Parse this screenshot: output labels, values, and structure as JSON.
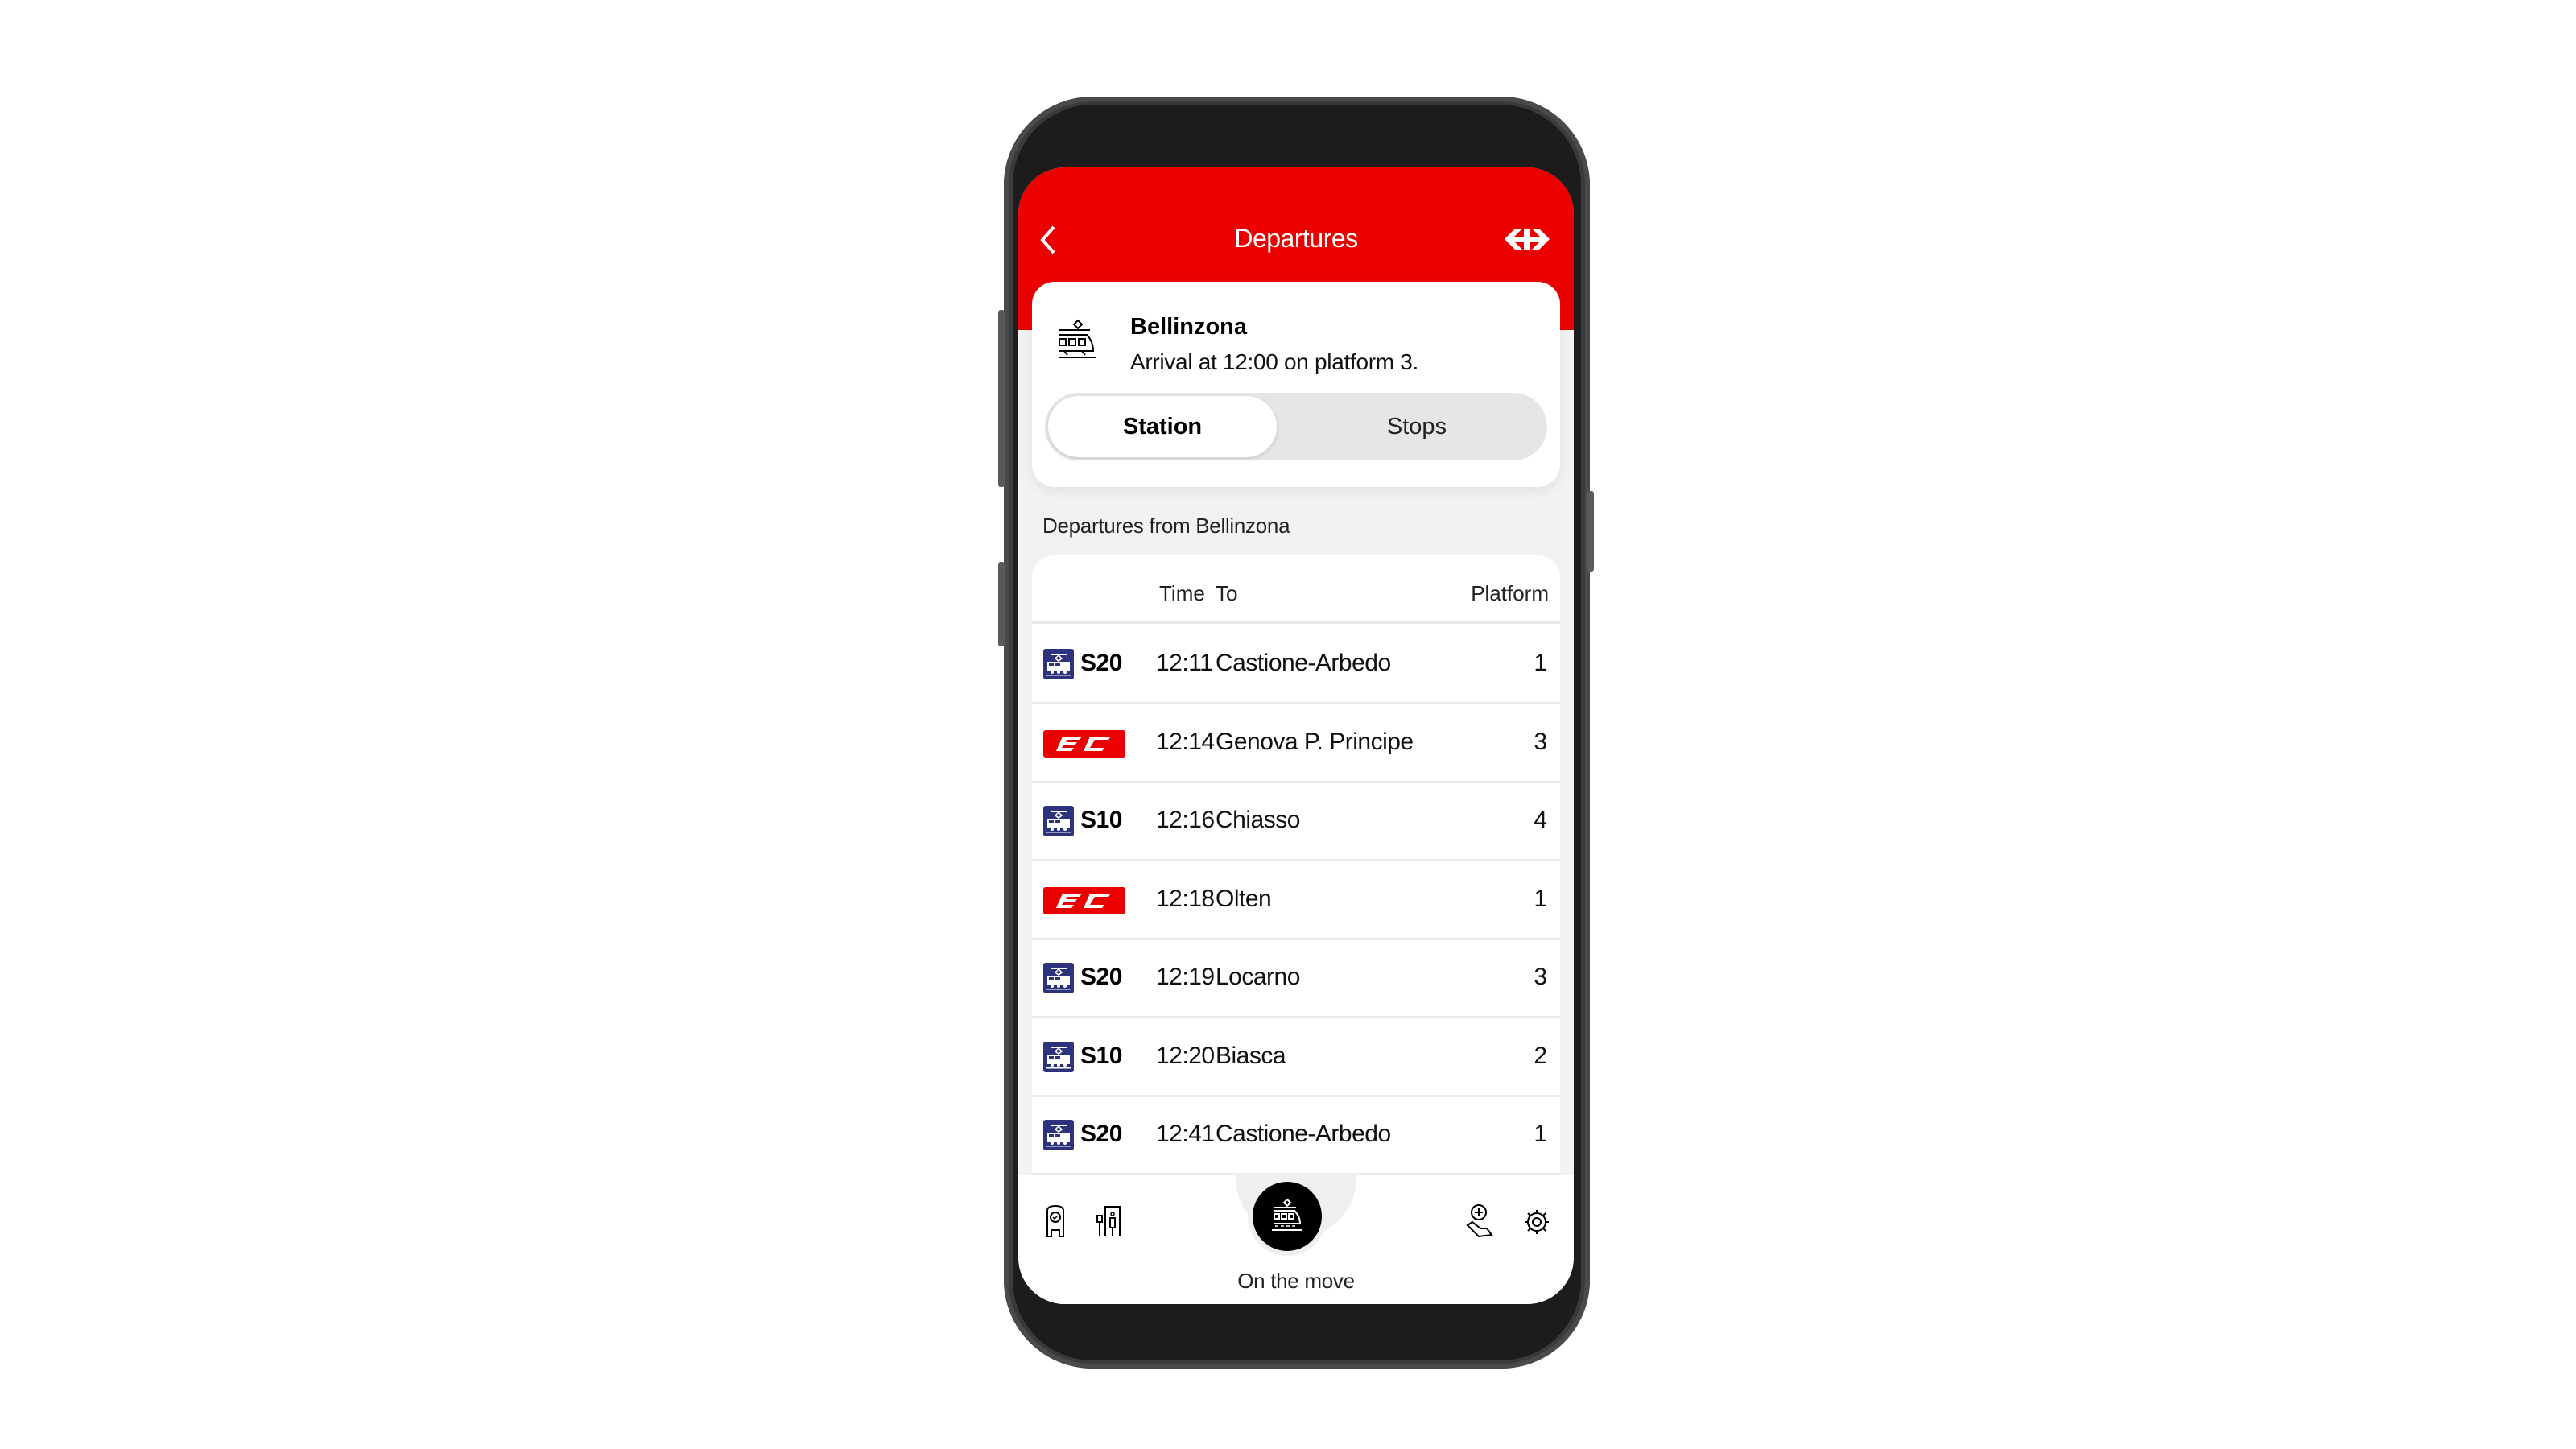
{
  "header": {
    "title": "Departures",
    "back_icon": "chevron-left-icon",
    "logo_icon": "sbb-logo-icon"
  },
  "journey": {
    "station": "Bellinzona",
    "arrival_text": "Arrival at 12:00 on platform 3.",
    "icon": "train-icon"
  },
  "segments": {
    "items": [
      "Station",
      "Stops"
    ],
    "active": "Station"
  },
  "departures": {
    "section_label": "Departures from Bellinzona",
    "columns": {
      "time": "Time",
      "to": "To",
      "platform": "Platform"
    },
    "rows": [
      {
        "type": "S",
        "line": "S20",
        "time": "12:11",
        "to": "Castione-Arbedo",
        "platform": "1"
      },
      {
        "type": "EC",
        "line": "EC",
        "time": "12:14",
        "to": "Genova P. Principe",
        "platform": "3"
      },
      {
        "type": "S",
        "line": "S10",
        "time": "12:16",
        "to": "Chiasso",
        "platform": "4"
      },
      {
        "type": "EC",
        "line": "EC",
        "time": "12:18",
        "to": "Olten",
        "platform": "1"
      },
      {
        "type": "S",
        "line": "S20",
        "time": "12:19",
        "to": "Locarno",
        "platform": "3"
      },
      {
        "type": "S",
        "line": "S10",
        "time": "12:20",
        "to": "Biasca",
        "platform": "2"
      },
      {
        "type": "S",
        "line": "S20",
        "time": "12:41",
        "to": "Castione-Arbedo",
        "platform": "1"
      }
    ]
  },
  "bottom_nav": {
    "items": [
      {
        "icon": "station-clock-icon"
      },
      {
        "icon": "platform-person-icon"
      },
      {
        "icon": "train-icon",
        "label": "On the move",
        "active": true
      },
      {
        "icon": "hand-plus-icon"
      },
      {
        "icon": "gear-icon"
      }
    ],
    "active_label": "On the move"
  },
  "colors": {
    "brand_red": "#eb0000",
    "s_bahn_blue": "#2d327d",
    "background": "#f2f2f2"
  }
}
